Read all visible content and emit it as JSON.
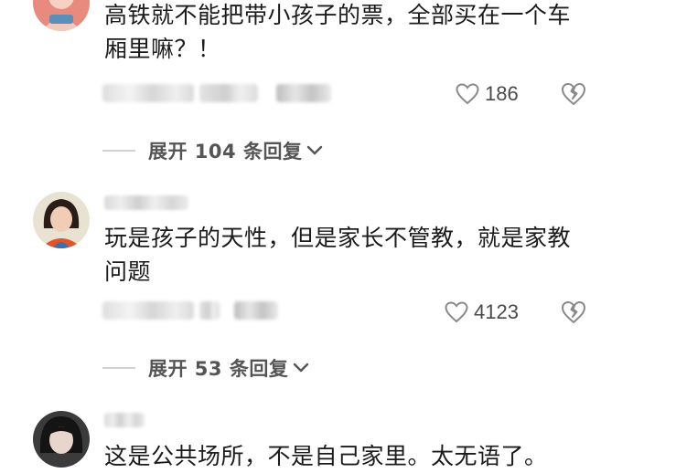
{
  "comments": [
    {
      "text": "高铁就不能把带小孩子的票，全部买在一个车厢里嘛？！",
      "likes": "186",
      "expand_label": "展开 104 条回复"
    },
    {
      "text": "玩是孩子的天性，但是家长不管教，就是家教问题",
      "likes": "4123",
      "expand_label": "展开 53 条回复"
    },
    {
      "text": "这是公共场所，不是自己家里。太无语了。"
    }
  ],
  "icons": {
    "like": "heart-outline-icon",
    "dislike": "broken-heart-icon",
    "expand": "chevron-down-icon"
  },
  "colors": {
    "text": "#1b1b1b",
    "meta": "#4a4a4a",
    "icon": "#8a8a8a",
    "expand_text": "#555555"
  }
}
